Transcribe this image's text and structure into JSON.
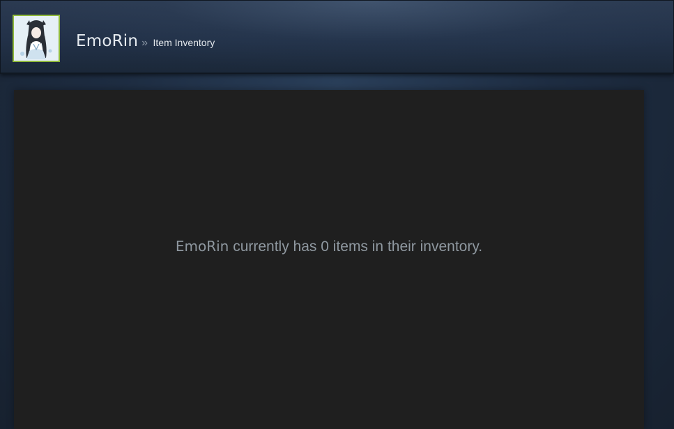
{
  "header": {
    "persona_name": "EmoRin",
    "separator": "»",
    "section_title": "Item Inventory"
  },
  "inventory": {
    "owner_name": "EmoRin",
    "empty_message": " currently has 0 items in their inventory."
  },
  "colors": {
    "avatar_border": "#8fb93b",
    "panel_bg": "#1f1f1f",
    "page_bg": "#1b2838",
    "message_text": "#8f98a0"
  },
  "icons": {
    "avatar": "user-avatar-image"
  }
}
